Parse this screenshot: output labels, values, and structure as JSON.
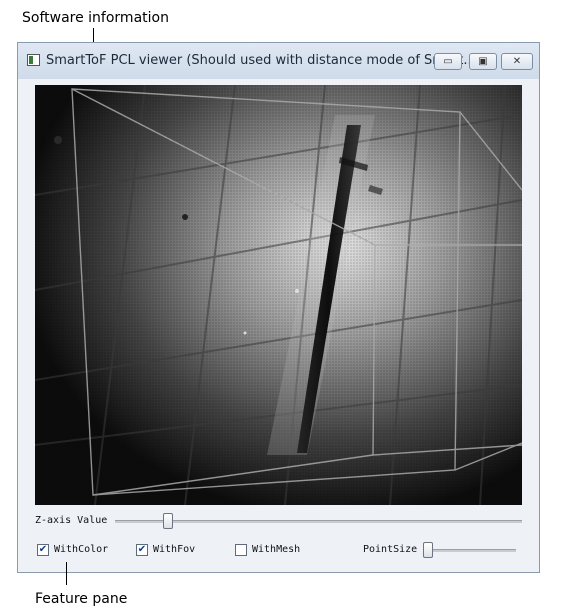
{
  "annotations": {
    "top": "Software information",
    "bottom": "Feature pane"
  },
  "window": {
    "title": "SmartToF PCL viewer (Should used with distance mode of Smart...",
    "buttons": {
      "minimize": "▭",
      "restore": "▣",
      "close": "✕"
    }
  },
  "controls": {
    "z_axis_label": "Z-axis Value",
    "z_axis_level": 0.12,
    "checkboxes": [
      {
        "label": "WithColor",
        "checked": true
      },
      {
        "label": "WithFov",
        "checked": true
      },
      {
        "label": "WithMesh",
        "checked": false
      }
    ],
    "point_size_label": "PointSize",
    "point_size_level": 0.0
  }
}
